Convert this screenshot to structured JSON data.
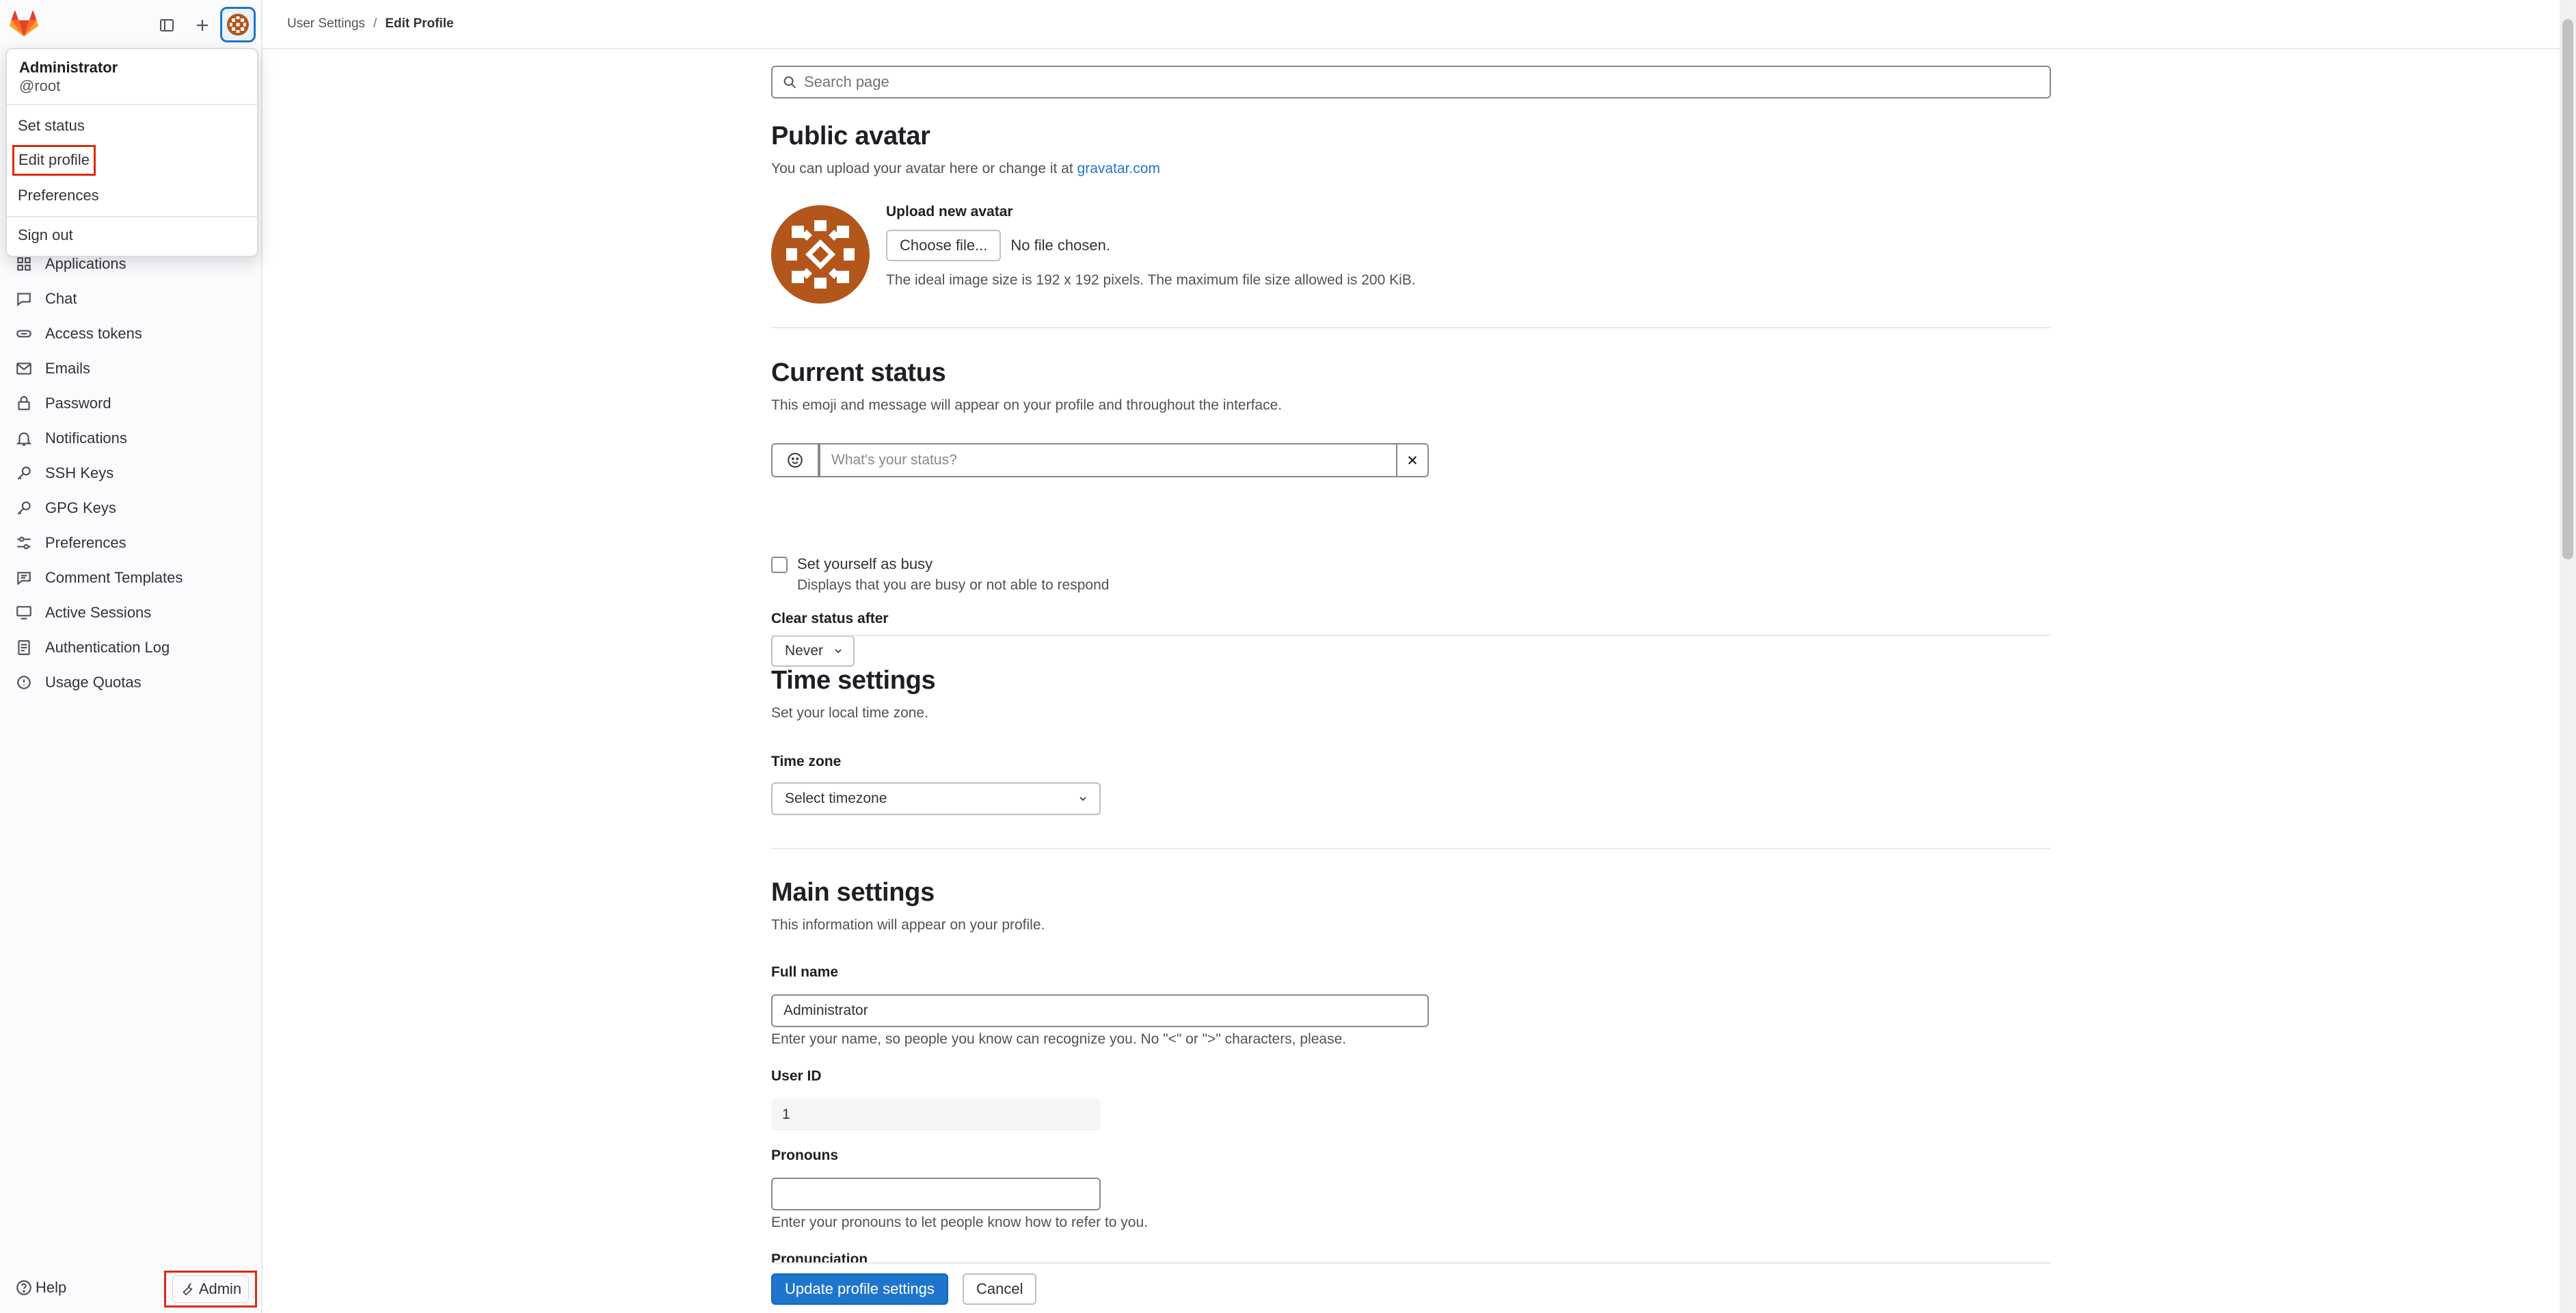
{
  "header": {
    "breadcrumb": {
      "parent": "User Settings",
      "separator": "/",
      "current": "Edit Profile"
    }
  },
  "topbar": {
    "logo_icon": "gitlab-tanuki-icon",
    "toggle_sidebar_icon": "sidebar-toggle-icon",
    "new_icon": "plus-icon",
    "avatar_icon": "user-avatar-icon"
  },
  "user_menu": {
    "name": "Administrator",
    "username": "@root",
    "items": [
      "Set status",
      "Edit profile",
      "Preferences"
    ],
    "sign_out": "Sign out"
  },
  "sidebar": {
    "items": [
      {
        "label": "Applications",
        "icon": "applications-icon"
      },
      {
        "label": "Chat",
        "icon": "comment-icon"
      },
      {
        "label": "Access tokens",
        "icon": "token-icon"
      },
      {
        "label": "Emails",
        "icon": "mail-icon"
      },
      {
        "label": "Password",
        "icon": "lock-icon"
      },
      {
        "label": "Notifications",
        "icon": "bell-icon"
      },
      {
        "label": "SSH Keys",
        "icon": "key-icon"
      },
      {
        "label": "GPG Keys",
        "icon": "key-icon"
      },
      {
        "label": "Preferences",
        "icon": "preferences-icon"
      },
      {
        "label": "Comment Templates",
        "icon": "comment-lines-icon"
      },
      {
        "label": "Active Sessions",
        "icon": "monitor-icon"
      },
      {
        "label": "Authentication Log",
        "icon": "log-icon"
      },
      {
        "label": "Usage Quotas",
        "icon": "quota-icon"
      }
    ],
    "help_label": "Help",
    "admin_label": "Admin"
  },
  "search": {
    "placeholder": "Search page"
  },
  "avatar_section": {
    "title": "Public avatar",
    "desc_prefix": "You can upload your avatar here or change it at ",
    "desc_link": "gravatar.com",
    "upload_label": "Upload new avatar",
    "choose_button": "Choose file...",
    "file_status": "No file chosen.",
    "hint": "The ideal image size is 192 x 192 pixels. The maximum file size allowed is 200 KiB.",
    "avatar_color": "#b3561b"
  },
  "status_section": {
    "title": "Current status",
    "desc": "This emoji and message will appear on your profile and throughout the interface.",
    "status_placeholder": "What's your status?",
    "busy_label": "Set yourself as busy",
    "busy_help": "Displays that you are busy or not able to respond",
    "clear_label": "Clear status after",
    "clear_value": "Never"
  },
  "time_section": {
    "title": "Time settings",
    "desc": "Set your local time zone.",
    "tz_label": "Time zone",
    "tz_value": "Select timezone"
  },
  "main_section": {
    "title": "Main settings",
    "desc": "This information will appear on your profile.",
    "fullname_label": "Full name",
    "fullname_value": "Administrator",
    "fullname_help": "Enter your name, so people you know can recognize you. No \"<\" or \">\" characters, please.",
    "userid_label": "User ID",
    "userid_value": "1",
    "pronouns_label": "Pronouns",
    "pronouns_value": "",
    "pronouns_help": "Enter your pronouns to let people know how to refer to you.",
    "pronunciation_label": "Pronunciation"
  },
  "footer": {
    "update_button": "Update profile settings",
    "cancel_button": "Cancel"
  },
  "colors": {
    "primary": "#1f75cb",
    "highlight_box": "#dd2b0e",
    "gitlab_orange": "#e24329"
  }
}
